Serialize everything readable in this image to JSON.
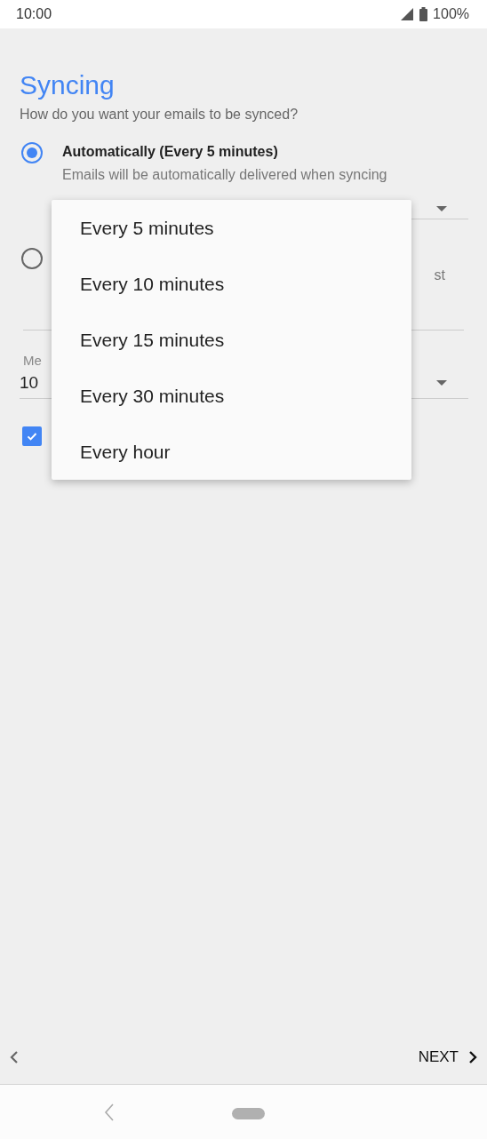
{
  "status_bar": {
    "time": "10:00",
    "battery": "100%"
  },
  "title": "Syncing",
  "subtitle": "How do you want your emails to be synced?",
  "sync_options": [
    {
      "label": "Automatically (Every 5 minutes)",
      "description": "Emails will be automatically delivered when syncing",
      "selected": true
    },
    {
      "description": "st",
      "selected": false
    }
  ],
  "messages_field": {
    "label": "Me",
    "value": "10"
  },
  "checkbox": {
    "checked": true
  },
  "dropdown_menu": {
    "items": [
      {
        "label": "Every 5 minutes"
      },
      {
        "label": "Every 10 minutes"
      },
      {
        "label": "Every 15 minutes"
      },
      {
        "label": "Every 30 minutes"
      },
      {
        "label": "Every hour"
      }
    ]
  },
  "footer": {
    "next": "NEXT"
  }
}
